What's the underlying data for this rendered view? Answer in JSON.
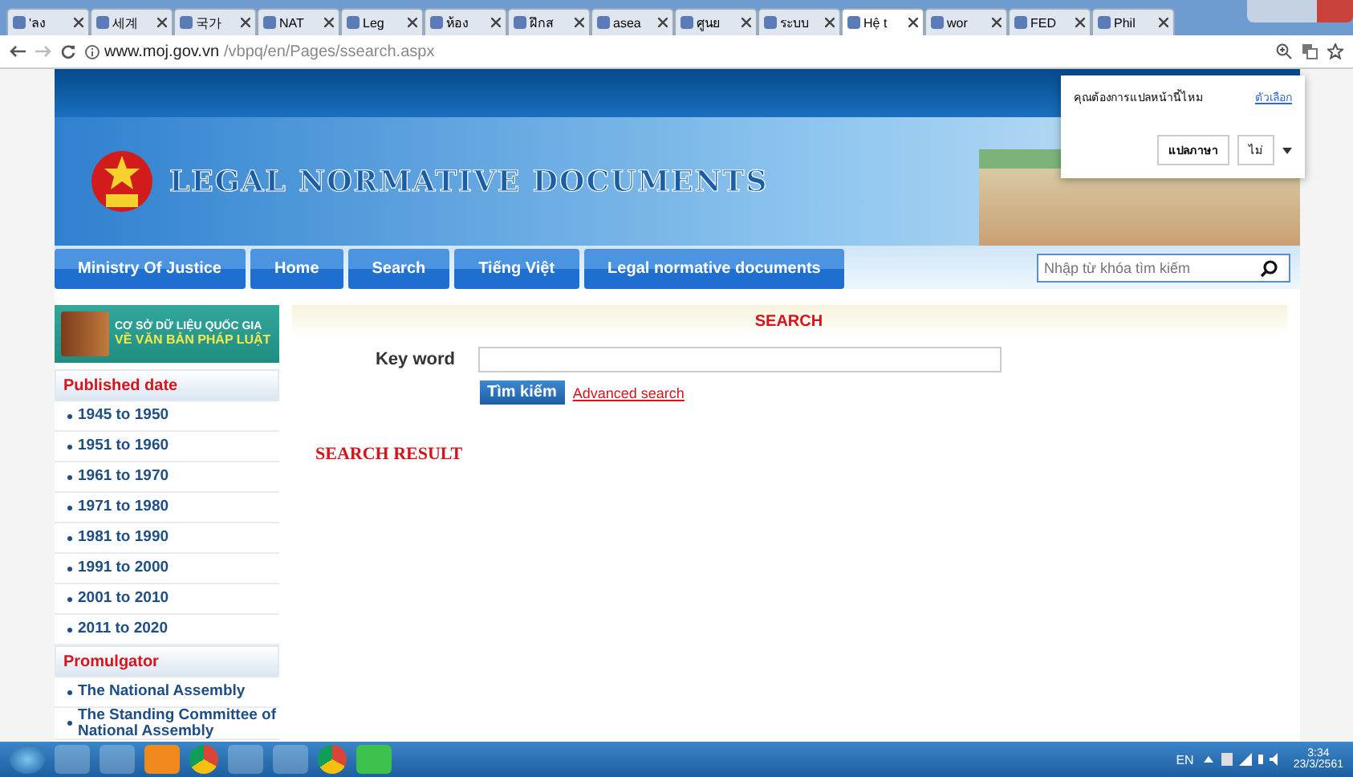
{
  "browser": {
    "tabs": [
      {
        "label": "'ลง",
        "selected": false
      },
      {
        "label": "세계",
        "selected": false
      },
      {
        "label": "국가",
        "selected": false
      },
      {
        "label": "NAT",
        "selected": false
      },
      {
        "label": "Leg",
        "selected": false
      },
      {
        "label": "ห้อง",
        "selected": false
      },
      {
        "label": "ฝึกส",
        "selected": false
      },
      {
        "label": "asea",
        "selected": false
      },
      {
        "label": "ศูนย",
        "selected": false
      },
      {
        "label": "ระบบ",
        "selected": false
      },
      {
        "label": "Hệ t",
        "selected": true
      },
      {
        "label": "wor",
        "selected": false
      },
      {
        "label": "FED",
        "selected": false
      },
      {
        "label": "Phil",
        "selected": false
      }
    ],
    "url_host": "www.moj.gov.vn",
    "url_path": "/vbpq/en/Pages/ssearch.aspx"
  },
  "translate_popup": {
    "question": "คุณต้องการแปลหน้านี้ไหม",
    "options_link": "ตัวเลือก",
    "translate_button": "แปลภาษา",
    "dropdown_value": "ไม่"
  },
  "site": {
    "title": "LEGAL NORMATIVE DOCUMENTS",
    "nav": [
      {
        "label": "Ministry Of Justice"
      },
      {
        "label": "Home"
      },
      {
        "label": "Search"
      },
      {
        "label": "Tiếng Việt"
      },
      {
        "label": "Legal normative documents"
      }
    ],
    "search_placeholder": "Nhập từ khóa tìm kiếm"
  },
  "sidebar": {
    "banner_line1": "CƠ SỞ DỮ LIỆU QUỐC GIA",
    "banner_line2": "VỀ VĂN BẢN PHÁP LUẬT",
    "sections": [
      {
        "heading": "Published date",
        "items": [
          "1945 to 1950",
          "1951 to 1960",
          "1961 to 1970",
          "1971 to 1980",
          "1981 to 1990",
          "1991 to 2000",
          "2001 to 2010",
          "2011 to 2020"
        ]
      },
      {
        "heading": "Promulgator",
        "items": [
          "The National Assembly",
          "The Standing Committee of National Assembly"
        ]
      }
    ]
  },
  "search_panel": {
    "heading": "SEARCH",
    "keyword_label": "Key word",
    "search_button": "Tìm kiếm",
    "advanced_link": "Advanced search",
    "result_heading": "SEARCH RESULT"
  },
  "taskbar": {
    "language": "EN",
    "time": "3:34",
    "date": "23/3/2561"
  }
}
